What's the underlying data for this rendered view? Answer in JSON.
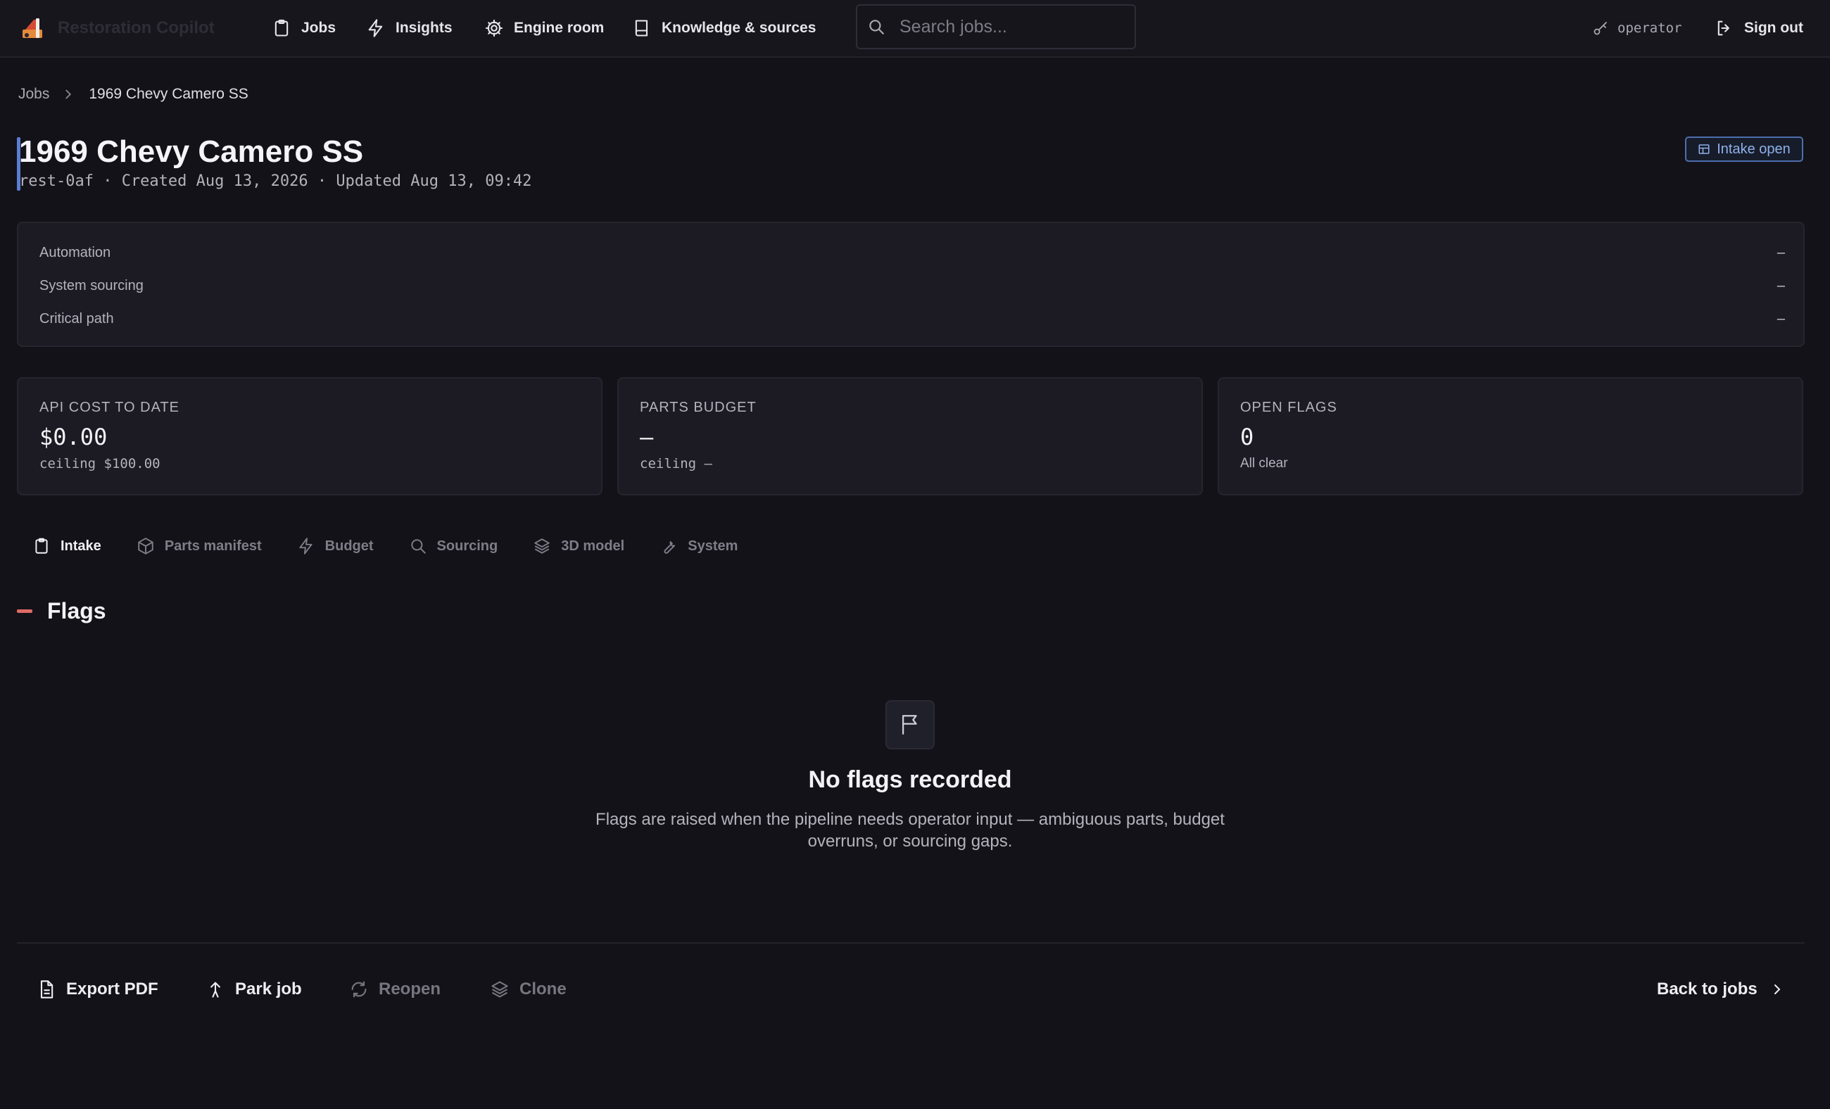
{
  "app": {
    "name": "Restoration Copilot"
  },
  "nav": {
    "items": [
      {
        "label": "Jobs",
        "icon": "clipboard-icon"
      },
      {
        "label": "Insights",
        "icon": "lightning-icon"
      },
      {
        "label": "Engine room",
        "icon": "gear-icon"
      },
      {
        "label": "Knowledge & sources",
        "icon": "book-icon"
      }
    ],
    "search_placeholder": "Search jobs...",
    "user": "operator",
    "sign_out": "Sign out"
  },
  "breadcrumb": {
    "parent": "Jobs",
    "current": "1969 Chevy Camero SS"
  },
  "job": {
    "title": "1969 Chevy Camero SS",
    "meta": "rest-0af · Created Aug 13, 2026 · Updated Aug 13, 09:42",
    "status_badge": "Intake open"
  },
  "status": [
    {
      "label": "Automation",
      "value": "–"
    },
    {
      "label": "System sourcing",
      "value": "–"
    },
    {
      "label": "Critical path",
      "value": "–"
    }
  ],
  "stats": [
    {
      "label": "API COST TO DATE",
      "value": "$0.00",
      "sub": "ceiling $100.00"
    },
    {
      "label": "PARTS BUDGET",
      "value": "—",
      "sub": "ceiling —"
    },
    {
      "label": "OPEN FLAGS",
      "value": "0",
      "sub": "All clear"
    }
  ],
  "tabs": [
    {
      "label": "Intake",
      "active": true
    },
    {
      "label": "Parts manifest"
    },
    {
      "label": "Budget"
    },
    {
      "label": "Sourcing"
    },
    {
      "label": "3D model"
    },
    {
      "label": "System"
    }
  ],
  "flags": {
    "title": "Flags",
    "empty_title": "No flags recorded",
    "empty_desc": "Flags are raised when the pipeline needs operator input — ambiguous parts, budget overruns, or sourcing gaps."
  },
  "actions": {
    "export_pdf": "Export PDF",
    "park_job": "Park job",
    "reopen": "Reopen",
    "clone": "Clone",
    "back": "Back to jobs"
  },
  "colors": {
    "background": "#131218",
    "panel": "#1c1b24",
    "accent_blue": "#5b7dd2",
    "badge_text": "#8fb0ea",
    "flag_red": "#e06a65"
  }
}
